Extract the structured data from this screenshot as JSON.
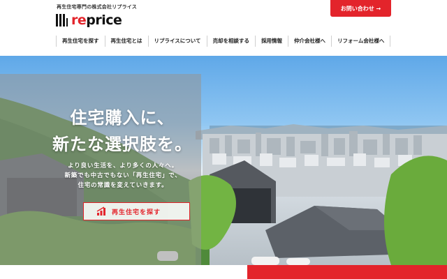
{
  "header": {
    "tagline": "再生住宅専門の株式会社リプライス",
    "logo_text_accent": "re",
    "logo_text_rest": "price",
    "contact_label": "お問い合わせ →"
  },
  "nav": {
    "items": [
      {
        "label": "再生住宅を探す"
      },
      {
        "label": "再生住宅とは"
      },
      {
        "label": "リプライスについて"
      },
      {
        "label": "売却を相談する"
      },
      {
        "label": "採用情報"
      },
      {
        "label": "仲介会社様へ"
      },
      {
        "label": "リフォーム会社様へ"
      }
    ]
  },
  "hero": {
    "headline_line1": "住宅購入に、",
    "headline_line2": "新たな選択肢を。",
    "subcopy_line1": "より良い生活を、より多くの人々へ。",
    "subcopy_line2": "新築でも中古でもない「再生住宅」で、",
    "subcopy_line3": "住宅の常識を変えていきます。",
    "cta_label": "再生住宅を探す",
    "cta_icon": "bar-chart-icon"
  },
  "colors": {
    "accent": "#e3242b",
    "sky": "#8fc6f2"
  }
}
